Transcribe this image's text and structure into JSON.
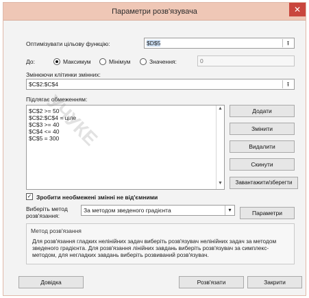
{
  "window": {
    "title": "Параметри розв'язувача",
    "close_glyph": "✕"
  },
  "objective": {
    "label": "Оптимізувати цільову функцію:",
    "value": "$D$5",
    "collapse_glyph": "⭱"
  },
  "to": {
    "label": "До:",
    "options": [
      "Максимум",
      "Мінімум",
      "Значення:"
    ],
    "selected": "Максимум",
    "value_field": "0"
  },
  "changing": {
    "label": "Змінюючи клітинки змінних:",
    "value": "$C$2:$C$4",
    "collapse_glyph": "⭱"
  },
  "constraints": {
    "label": "Підлягає обмеженням:",
    "items": [
      "$C$2 >= 50",
      "$C$2:$C$4 = ціле",
      "$C$3 >= 40",
      "$C$4 <= 40",
      "$C$5 = 300"
    ],
    "scroll_up": "▲",
    "scroll_down": "▼"
  },
  "side_buttons": [
    "Додати",
    "Змінити",
    "Видалити",
    "Скинути",
    "Завантажити/зберегти"
  ],
  "nonneg": {
    "checked": true,
    "check_glyph": "✓",
    "label": "Зробити необмежені змінні не від'ємними"
  },
  "method": {
    "label": "Виберіть метод розв'язання:",
    "selected": "За методом зведеного градієнта",
    "arrow_glyph": "▾",
    "params_button": "Параметри"
  },
  "method_info": {
    "title": "Метод розв'язання",
    "text": "Для розв'язання гладких нелінійних задач виберіть розв'язувач нелінійних задач за методом зведеного градієнта. Для розв'язання лінійних завдань виберіть розв'язувач за симплекс-методом, для негладких завдань виберіть розвиваний розв'язувач."
  },
  "footer": {
    "help": "Довідка",
    "solve": "Розв'язати",
    "close": "Закрити"
  },
  "watermark": "УЧУКЕ"
}
